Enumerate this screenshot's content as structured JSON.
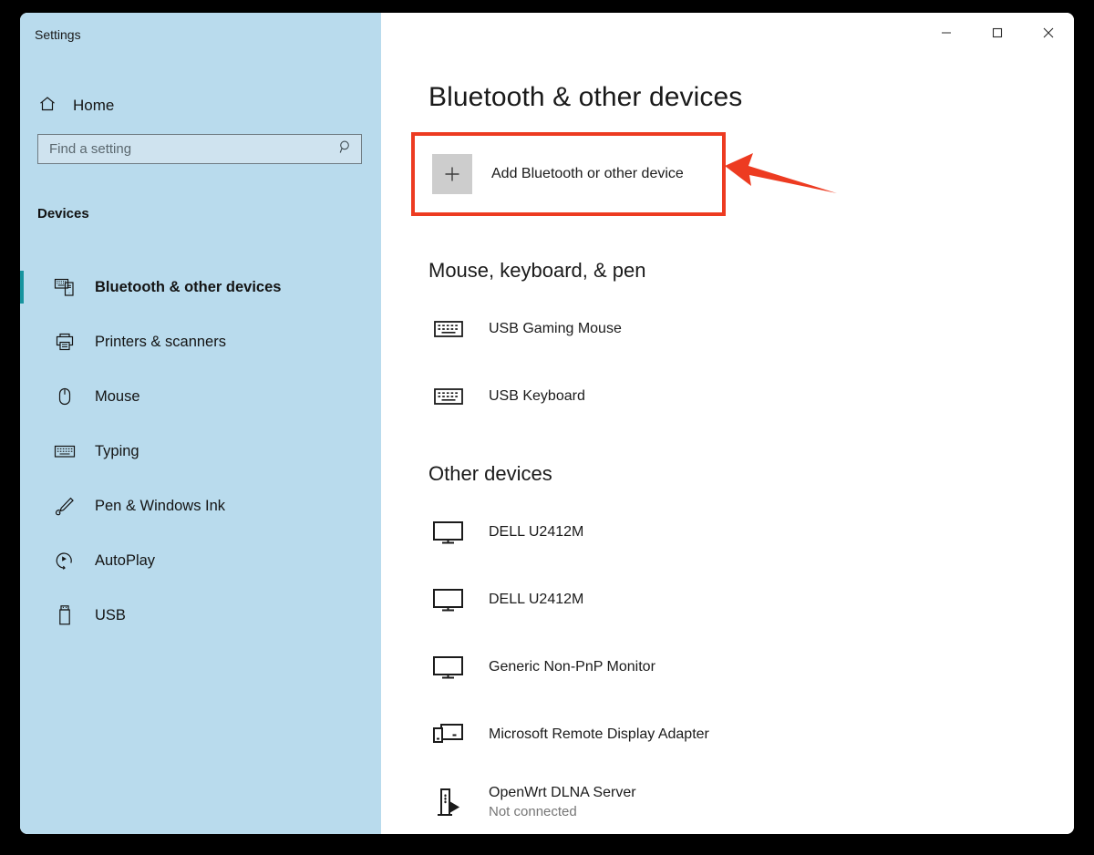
{
  "window": {
    "app_title": "Settings",
    "controls": [
      {
        "name": "minimize",
        "glyph": "─"
      },
      {
        "name": "maximize",
        "glyph": "□"
      },
      {
        "name": "close",
        "glyph": "✕"
      }
    ]
  },
  "sidebar": {
    "home_label": "Home",
    "search": {
      "placeholder": "Find a setting",
      "value": ""
    },
    "category_heading": "Devices",
    "items": [
      {
        "label": "Bluetooth & other devices",
        "icon": "bluetooth-devices-icon",
        "selected": true
      },
      {
        "label": "Printers & scanners",
        "icon": "printer-icon",
        "selected": false
      },
      {
        "label": "Mouse",
        "icon": "mouse-icon",
        "selected": false
      },
      {
        "label": "Typing",
        "icon": "keyboard-icon",
        "selected": false
      },
      {
        "label": "Pen & Windows Ink",
        "icon": "pen-icon",
        "selected": false
      },
      {
        "label": "AutoPlay",
        "icon": "autoplay-icon",
        "selected": false
      },
      {
        "label": "USB",
        "icon": "usb-icon",
        "selected": false
      }
    ]
  },
  "main": {
    "page_title": "Bluetooth & other devices",
    "add_device": {
      "label": "Add Bluetooth or other device",
      "plus_glyph": "+"
    },
    "sections": [
      {
        "title": "Mouse, keyboard, & pen",
        "devices": [
          {
            "name": "USB Gaming Mouse",
            "status": "",
            "icon": "keyboard-icon"
          },
          {
            "name": "USB Keyboard",
            "status": "",
            "icon": "keyboard-icon"
          }
        ]
      },
      {
        "title": "Other devices",
        "devices": [
          {
            "name": "DELL U2412M",
            "status": "",
            "icon": "monitor-icon"
          },
          {
            "name": "DELL U2412M",
            "status": "",
            "icon": "monitor-icon"
          },
          {
            "name": "Generic Non-PnP Monitor",
            "status": "",
            "icon": "monitor-icon"
          },
          {
            "name": "Microsoft Remote Display Adapter",
            "status": "",
            "icon": "remote-display-icon"
          },
          {
            "name": "OpenWrt DLNA Server",
            "status": "Not connected",
            "icon": "media-server-icon"
          }
        ]
      }
    ]
  },
  "annotation": {
    "highlight_color": "#ed3b21",
    "arrow_color": "#ed3b21",
    "target": "Add Bluetooth or other device"
  },
  "colors": {
    "sidebar_background": "#b9dbed",
    "accent_bar": "#17949f",
    "main_background": "#ffffff",
    "outer_background": "#000000",
    "add_tile": "#cdcdcd"
  }
}
